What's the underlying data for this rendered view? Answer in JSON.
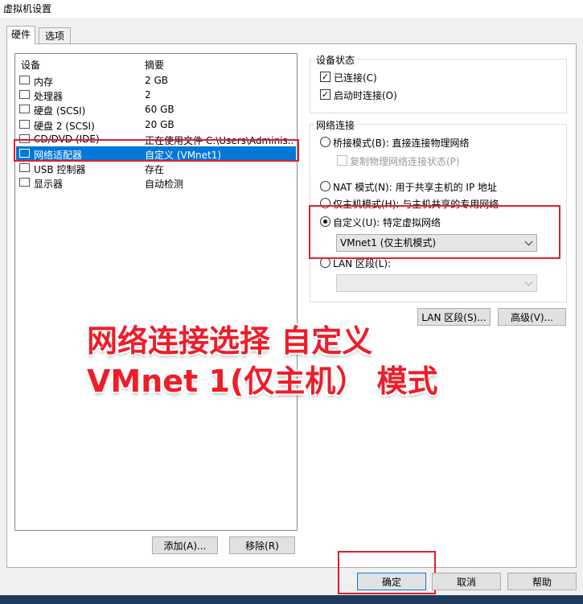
{
  "window": {
    "title": "虚拟机设置"
  },
  "tabs": [
    {
      "label": "硬件"
    },
    {
      "label": "选项"
    }
  ],
  "device_list": {
    "headers": {
      "device": "设备",
      "summary": "摘要"
    },
    "rows": [
      {
        "device": "内存",
        "summary": "2 GB",
        "icon": "memory-icon"
      },
      {
        "device": "处理器",
        "summary": "2",
        "icon": "cpu-icon"
      },
      {
        "device": "硬盘 (SCSI)",
        "summary": "60 GB",
        "icon": "hard-disk-icon"
      },
      {
        "device": "硬盘 2 (SCSI)",
        "summary": "20 GB",
        "icon": "hard-disk-icon"
      },
      {
        "device": "CD/DVD (IDE)",
        "summary": "正在使用文件 C:\\Users\\Adminis...",
        "icon": "cd-dvd-icon"
      },
      {
        "device": "网络适配器",
        "summary": "自定义 (VMnet1)",
        "icon": "network-adapter-icon"
      },
      {
        "device": "USB 控制器",
        "summary": "存在",
        "icon": "usb-icon"
      },
      {
        "device": "显示器",
        "summary": "自动检测",
        "icon": "monitor-icon"
      }
    ],
    "selected_index": 5,
    "add_button": "添加(A)...",
    "remove_button": "移除(R)"
  },
  "device_status": {
    "title": "设备状态",
    "connected": {
      "label": "已连接(C)",
      "checked": true
    },
    "connect_at_power_on": {
      "label": "启动时连接(O)",
      "checked": true
    }
  },
  "network_connection": {
    "title": "网络连接",
    "bridged": "桥接模式(B): 直接连接物理网络",
    "replicate": "复制物理网络连接状态(P)",
    "nat": "NAT 模式(N): 用于共享主机的 IP 地址",
    "host_only": "仅主机模式(H): 与主机共享的专用网络",
    "custom": "自定义(U): 特定虚拟网络",
    "custom_selected_value": "VMnet1 (仅主机模式)",
    "lan_segment": "LAN 区段(L):",
    "lan_segment_value": "",
    "lan_segments_button": "LAN 区段(S)...",
    "advanced_button": "高级(V)..."
  },
  "footer": {
    "ok": "确定",
    "cancel": "取消",
    "help": "帮助"
  },
  "annotation": {
    "line1": "网络连接选择 自定义",
    "line2": "VMnet 1(仅主机）  模式"
  },
  "colors": {
    "selection": "#0078d7",
    "annotation_red": "#ee1d2a"
  }
}
